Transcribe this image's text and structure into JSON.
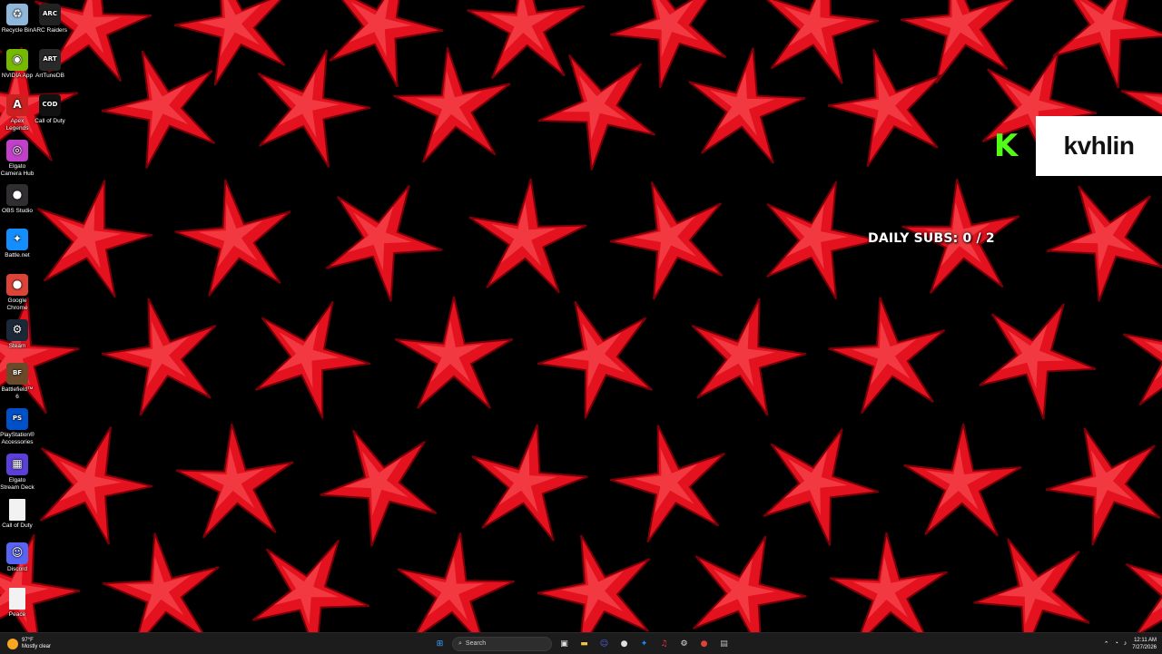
{
  "desktop_icons": [
    {
      "label": "Recycle Bin",
      "icon": "recycle-bin-icon",
      "color": "#8fb7d9",
      "glyph": "♻"
    },
    {
      "label": "ARC Raiders",
      "icon": "arc-raiders-icon",
      "color": "#222222",
      "glyph": "ARC"
    },
    {
      "label": "NVIDIA App",
      "icon": "nvidia-icon",
      "color": "#76b900",
      "glyph": "◉"
    },
    {
      "label": "ArtTuneDB",
      "icon": "arttunedb-icon",
      "color": "#2a2a2a",
      "glyph": "ART"
    },
    {
      "label": "Apex Legends",
      "icon": "apex-legends-icon",
      "color": "#cc1f1f",
      "glyph": "A"
    },
    {
      "label": "Call of Duty",
      "icon": "call-of-duty-icon",
      "color": "#111111",
      "glyph": "COD"
    },
    {
      "label": "Elgato Camera Hub",
      "icon": "elgato-camera-hub-icon",
      "color": "#c040c8",
      "glyph": "◎"
    },
    {
      "label": "OBS Studio",
      "icon": "obs-studio-icon",
      "color": "#302e31",
      "glyph": "●"
    },
    {
      "label": "Battle.net",
      "icon": "battlenet-icon",
      "color": "#148eff",
      "glyph": "✦"
    },
    {
      "label": "Google Chrome",
      "icon": "chrome-icon",
      "color": "#db4437",
      "glyph": "●"
    },
    {
      "label": "Steam",
      "icon": "steam-icon",
      "color": "#1b2838",
      "glyph": "⚙"
    },
    {
      "label": "Battlefield™ 6",
      "icon": "battlefield-icon",
      "color": "#6b4a2a",
      "glyph": "BF"
    },
    {
      "label": "PlayStation® Accessories",
      "icon": "playstation-accessories-icon",
      "color": "#0050c8",
      "glyph": "PS"
    },
    {
      "label": "Elgato Stream Deck",
      "icon": "elgato-stream-deck-icon",
      "color": "#5b3fd6",
      "glyph": "▦"
    },
    {
      "label": "Call of Duty",
      "icon": "call-of-duty-file-icon",
      "color": "#f2f2f2",
      "glyph": ""
    },
    {
      "label": "Discord",
      "icon": "discord-icon",
      "color": "#5865f2",
      "glyph": "☺"
    },
    {
      "label": "Peace",
      "icon": "peace-file-icon",
      "color": "#f2f2f2",
      "glyph": ""
    }
  ],
  "overlay": {
    "kick_logo": "K",
    "kick_color": "#53fc18",
    "username": "kvhlin",
    "daily_subs": "DAILY SUBS: 0 / 2"
  },
  "taskbar": {
    "weather_temp": "97°F",
    "weather_desc": "Mostly clear",
    "search_placeholder": "Search",
    "time": "12:11 AM",
    "date": "7/27/2026",
    "pinned": [
      {
        "icon": "start-icon",
        "glyph": "⊞",
        "color": "#3aa0ff"
      },
      {
        "icon": "search-icon",
        "glyph": "",
        "color": ""
      },
      {
        "icon": "task-view-icon",
        "glyph": "▣",
        "color": "#e0e0e0"
      },
      {
        "icon": "file-explorer-icon",
        "glyph": "▬",
        "color": "#f4c542"
      },
      {
        "icon": "discord-taskbar-icon",
        "glyph": "☺",
        "color": "#5865f2"
      },
      {
        "icon": "obs-taskbar-icon",
        "glyph": "●",
        "color": "#e0e0e0"
      },
      {
        "icon": "battlenet-taskbar-icon",
        "glyph": "✦",
        "color": "#148eff"
      },
      {
        "icon": "music-app-icon",
        "glyph": "♫",
        "color": "#fa2d48"
      },
      {
        "icon": "settings-icon",
        "glyph": "⚙",
        "color": "#e0e0e0"
      },
      {
        "icon": "chrome-taskbar-icon",
        "glyph": "●",
        "color": "#db4437"
      },
      {
        "icon": "app-taskbar-icon",
        "glyph": "▤",
        "color": "#bbbbbb"
      }
    ]
  },
  "wallpaper": {
    "star_color": "#e3121e",
    "background": "#000000"
  }
}
